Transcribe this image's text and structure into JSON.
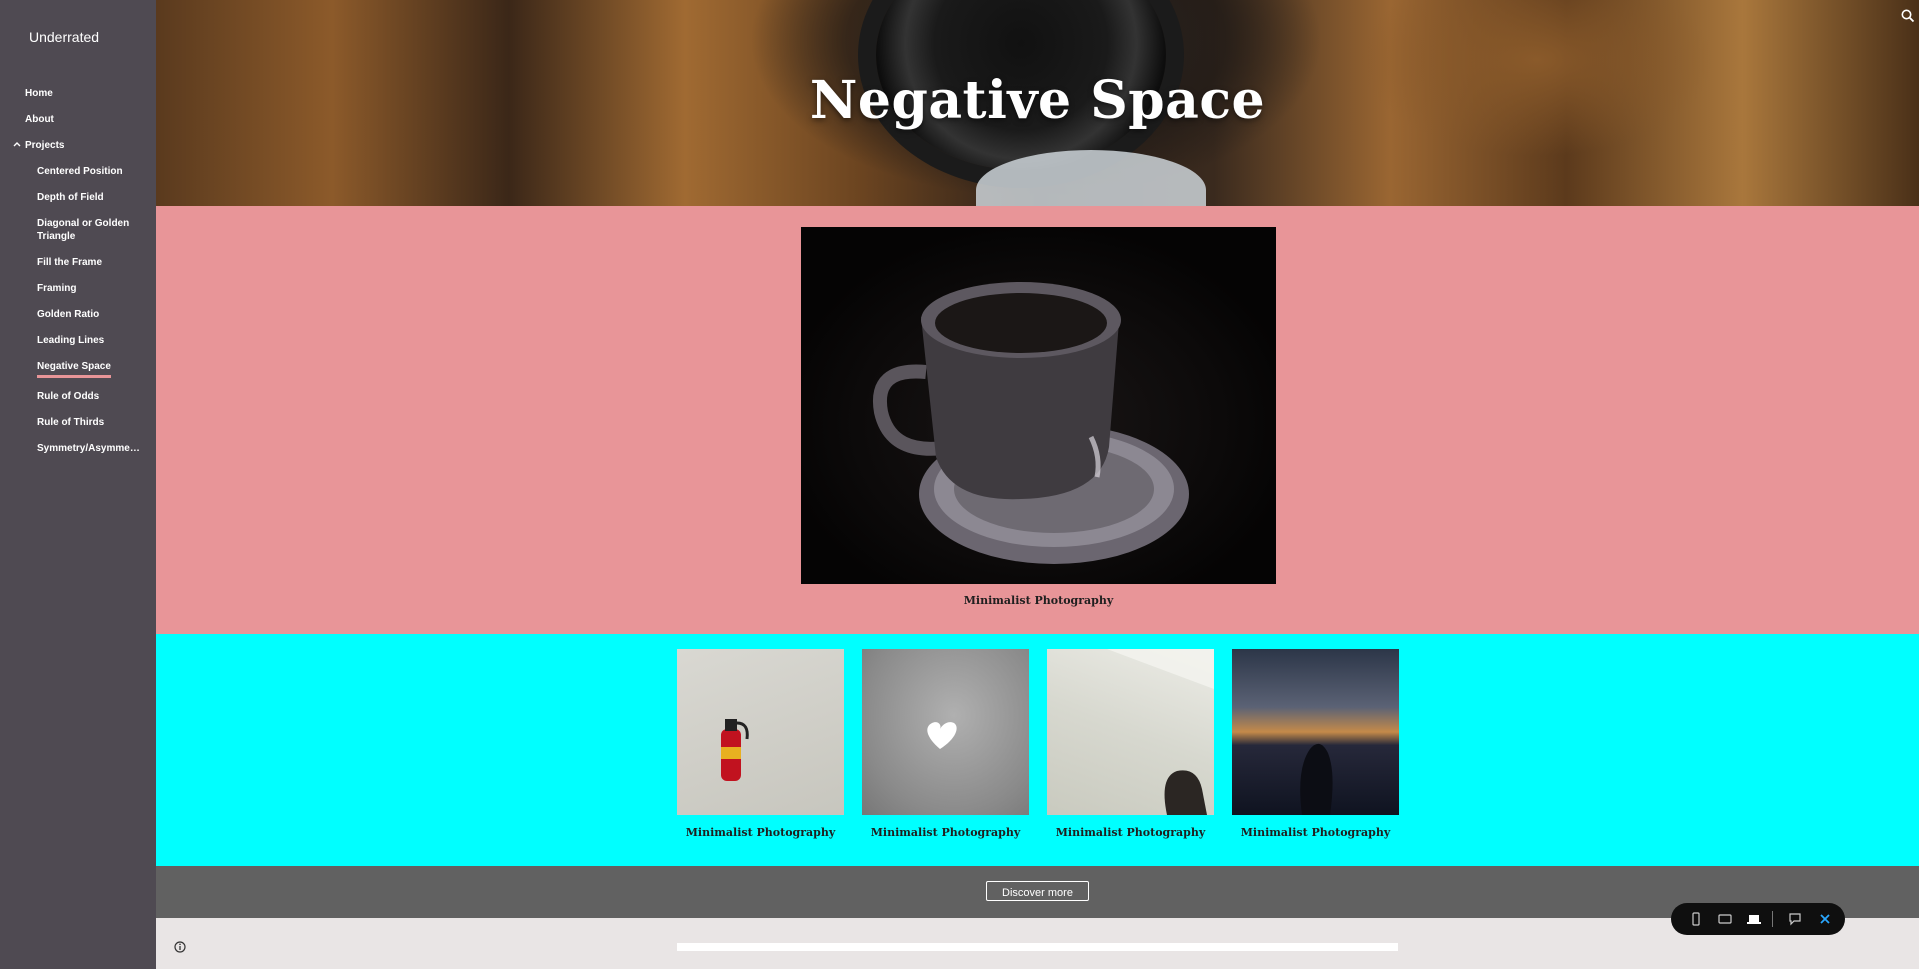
{
  "site": {
    "title": "Underrated"
  },
  "nav": {
    "home": "Home",
    "about": "About",
    "projects": "Projects",
    "sub_items": [
      {
        "label": "Centered Position"
      },
      {
        "label": "Depth of Field"
      },
      {
        "label": "Diagonal or Golden Triangle"
      },
      {
        "label": "Fill the Frame"
      },
      {
        "label": "Framing"
      },
      {
        "label": "Golden Ratio"
      },
      {
        "label": "Leading Lines"
      },
      {
        "label": "Negative Space"
      },
      {
        "label": "Rule of Odds"
      },
      {
        "label": "Rule of Thirds"
      },
      {
        "label": "Symmetry/Asymmet..."
      }
    ],
    "active": "Negative Space"
  },
  "hero": {
    "title": "Negative Space"
  },
  "feature": {
    "caption": "Minimalist Photography"
  },
  "gallery": {
    "items": [
      {
        "caption": "Minimalist Photography"
      },
      {
        "caption": "Minimalist Photography"
      },
      {
        "caption": "Minimalist Photography"
      },
      {
        "caption": "Minimalist Photography"
      }
    ]
  },
  "discover": {
    "label": "Discover more"
  },
  "colors": {
    "sidebar": "#4f4a52",
    "feature_bg": "#e89598",
    "strip_bg": "#00ffff",
    "discover_bg": "#616161",
    "active_underline": "#e89598",
    "close_accent": "#2aa7ff"
  },
  "icons": {
    "search": "search-icon",
    "info": "info-icon",
    "phone": "phone-view-icon",
    "tablet": "tablet-view-icon",
    "laptop": "laptop-view-icon",
    "feedback": "feedback-icon",
    "close": "close-icon"
  }
}
